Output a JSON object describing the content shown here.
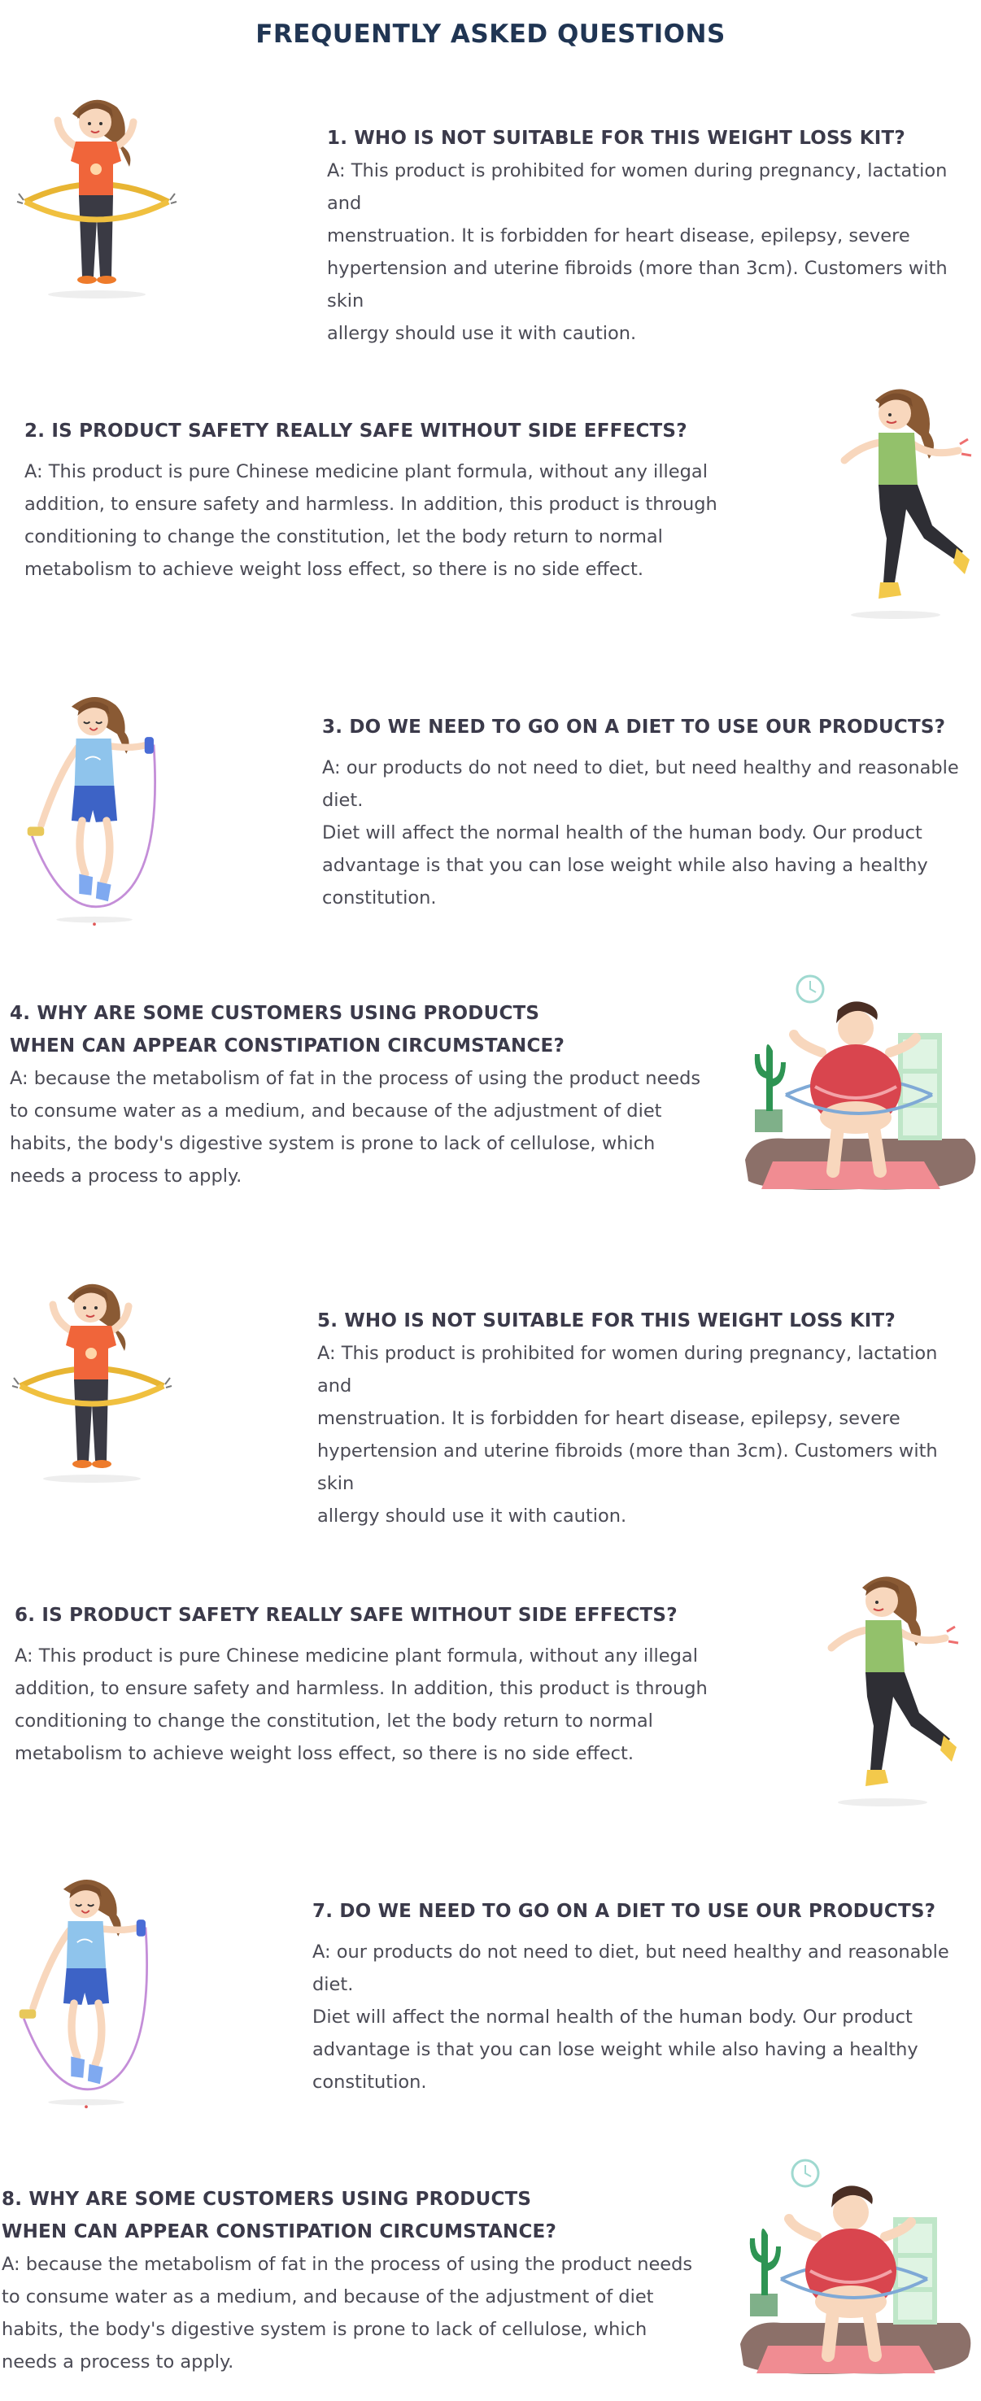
{
  "page": {
    "title": "FREQUENTLY ASKED QUESTIONS"
  },
  "faqs": [
    {
      "question": "1. WHO IS NOT SUITABLE FOR THIS WEIGHT LOSS KIT?",
      "answer": "A: This product is prohibited for women during pregnancy, lactation and\nmenstruation. It is forbidden for heart disease, epilepsy, severe\nhypertension and uterine fibroids (more than 3cm). Customers with skin\nallergy should use it with caution.",
      "illustration": "woman-hula-hoop-icon"
    },
    {
      "question": "2. IS PRODUCT SAFETY REALLY SAFE WITHOUT SIDE EFFECTS?",
      "answer": "A: This product is pure Chinese medicine plant formula, without any illegal\naddition, to ensure safety and harmless. In addition, this product is through\nconditioning to change the constitution, let the body return to normal\nmetabolism to achieve weight loss effect, so there is no side effect.",
      "illustration": "woman-running-icon"
    },
    {
      "question": "3. DO WE NEED TO GO ON A DIET TO USE OUR PRODUCTS?",
      "answer": "A: our products do not need to diet, but need healthy and reasonable diet.\nDiet will affect the normal health of the human body. Our product\nadvantage is that you can lose weight while also having a healthy\nconstitution.",
      "illustration": "woman-jump-rope-icon"
    },
    {
      "question": "4. WHY ARE SOME CUSTOMERS USING PRODUCTS\nWHEN CAN APPEAR CONSTIPATION CIRCUMSTANCE?",
      "answer": "A: because the metabolism of fat in the process of using the product needs\nto consume water as a medium, and because of the adjustment of diet\nhabits, the body's digestive system is prone to lack of cellulose, which\nneeds a process to apply.",
      "illustration": "woman-hula-hoop-room-icon"
    },
    {
      "question": "5. WHO IS NOT SUITABLE FOR THIS WEIGHT LOSS KIT?",
      "answer": "A: This product is prohibited for women during pregnancy, lactation and\nmenstruation. It is forbidden for heart disease, epilepsy, severe\nhypertension and uterine fibroids (more than 3cm). Customers with skin\nallergy should use it with caution.",
      "illustration": "woman-hula-hoop-icon"
    },
    {
      "question": "6. IS PRODUCT SAFETY REALLY SAFE WITHOUT SIDE EFFECTS?",
      "answer": "A: This product is pure Chinese medicine plant formula, without any illegal\naddition, to ensure safety and harmless. In addition, this product is through\nconditioning to change the constitution, let the body return to normal\nmetabolism to achieve weight loss effect, so there is no side effect.",
      "illustration": "woman-running-icon"
    },
    {
      "question": "7. DO WE NEED TO GO ON A DIET TO USE OUR PRODUCTS?",
      "answer": "A: our products do not need to diet, but need healthy and reasonable diet.\nDiet will affect the normal health of the human body. Our product\nadvantage is that you can lose weight while also having a healthy\nconstitution.",
      "illustration": "woman-jump-rope-icon"
    },
    {
      "question": "8. WHY ARE SOME CUSTOMERS USING PRODUCTS\nWHEN CAN APPEAR CONSTIPATION CIRCUMSTANCE?",
      "answer": "A: because the metabolism of fat in the process of using the product needs\nto consume water as a medium, and because of the adjustment of diet\nhabits, the body's digestive system is prone to lack of cellulose, which\nneeds a process to apply.",
      "illustration": "woman-hula-hoop-room-icon"
    }
  ],
  "colors": {
    "title": "#203553",
    "question": "#3b3a4a",
    "answer": "#4b4b55"
  }
}
